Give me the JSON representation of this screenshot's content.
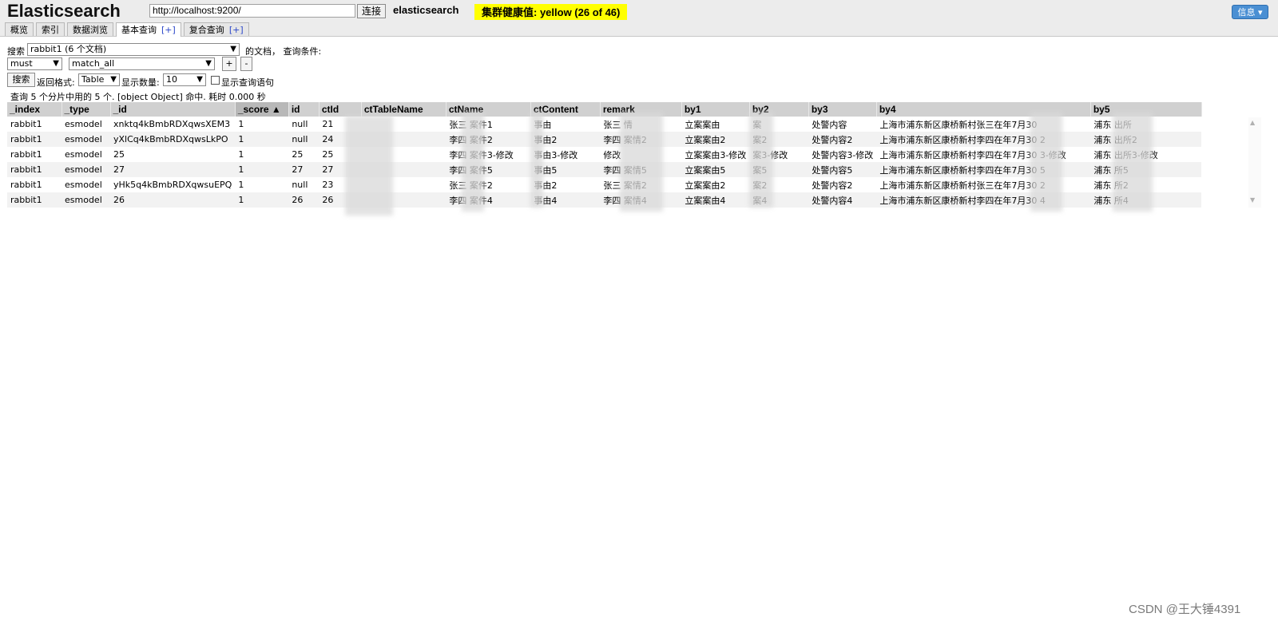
{
  "header": {
    "logo": "Elasticsearch",
    "url_value": "http://localhost:9200/",
    "connect_label": "连接",
    "cluster_name": "elasticsearch",
    "health": "集群健康值: yellow (26 of 46)",
    "info_label": "信息 ▾"
  },
  "tabs": [
    {
      "label": "概览"
    },
    {
      "label": "索引"
    },
    {
      "label": "数据浏览"
    },
    {
      "label": "基本查询",
      "plus": "[+]"
    },
    {
      "label": "复合查询",
      "plus": "[+]"
    }
  ],
  "query": {
    "search_label": "搜索",
    "index_select": "rabbit1 (6 个文档)",
    "doc_suffix": "的文档，  查询条件:",
    "bool_select": "must",
    "clause_select": "match_all",
    "add_label": "+",
    "remove_label": "-",
    "search_button": "搜索",
    "format_label": "返回格式:",
    "format_select": "Table",
    "size_label": "显示数量:",
    "size_select": "10",
    "show_query_label": "显示查询语句"
  },
  "stats": "查询 5 个分片中用的 5 个. [object Object] 命中. 耗时 0.000 秒",
  "table": {
    "columns": [
      "_index",
      "_type",
      "_id",
      "_score ▲",
      "id",
      "ctId",
      "ctTableName",
      "ctName",
      "ctContent",
      "remark",
      "by1",
      "by2",
      "by3",
      "by4",
      "by5"
    ],
    "rows": [
      [
        "rabbit1",
        "esmodel",
        "xnktq4kBmbRDXqwsXEM3",
        "1",
        "null",
        "21",
        "",
        "张三 案件1",
        "事由",
        "张三 情",
        "立案案由",
        "案",
        "处警内容",
        "上海市浦东新区康桥新村张三在年7月30 ",
        "浦东 出所"
      ],
      [
        "rabbit1",
        "esmodel",
        "yXlCq4kBmbRDXqwsLkPO",
        "1",
        "null",
        "24",
        "",
        "李四 案件2",
        "事由2",
        "李四 案情2",
        "立案案由2",
        "案2",
        "处警内容2",
        "上海市浦东新区康桥新村李四在年7月30 2",
        "浦东 出所2"
      ],
      [
        "rabbit1",
        "esmodel",
        "25",
        "1",
        "25",
        "25",
        "",
        "李四 案件3-修改",
        "事由3-修改",
        "修改",
        "立案案由3-修改",
        "案3-修改",
        "处警内容3-修改",
        "上海市浦东新区康桥新村李四在年7月30 3-修改",
        "浦东 出所3-修改"
      ],
      [
        "rabbit1",
        "esmodel",
        "27",
        "1",
        "27",
        "27",
        "",
        "李四 案件5",
        "事由5",
        "李四 案情5",
        "立案案由5",
        "案5",
        "处警内容5",
        "上海市浦东新区康桥新村李四在年7月30 5",
        "浦东 所5"
      ],
      [
        "rabbit1",
        "esmodel",
        "yHk5q4kBmbRDXqwsuEPQ",
        "1",
        "null",
        "23",
        "",
        "张三 案件2",
        "事由2",
        "张三 案情2",
        "立案案由2",
        "案2",
        "处警内容2",
        "上海市浦东新区康桥新村张三在年7月30 2",
        "浦东 所2"
      ],
      [
        "rabbit1",
        "esmodel",
        "26",
        "1",
        "26",
        "26",
        "",
        "李四 案件4",
        "事由4",
        "李四 案情4",
        "立案案由4",
        "案4",
        "处警内容4",
        "上海市浦东新区康桥新村李四在年7月30 4",
        "浦东 所4"
      ]
    ]
  },
  "watermark": "CSDN @王大锤4391",
  "colors": {
    "health_bg": "#ffff00",
    "info_btn": "#4a8fd3",
    "header_bg": "#d0d0d0"
  }
}
